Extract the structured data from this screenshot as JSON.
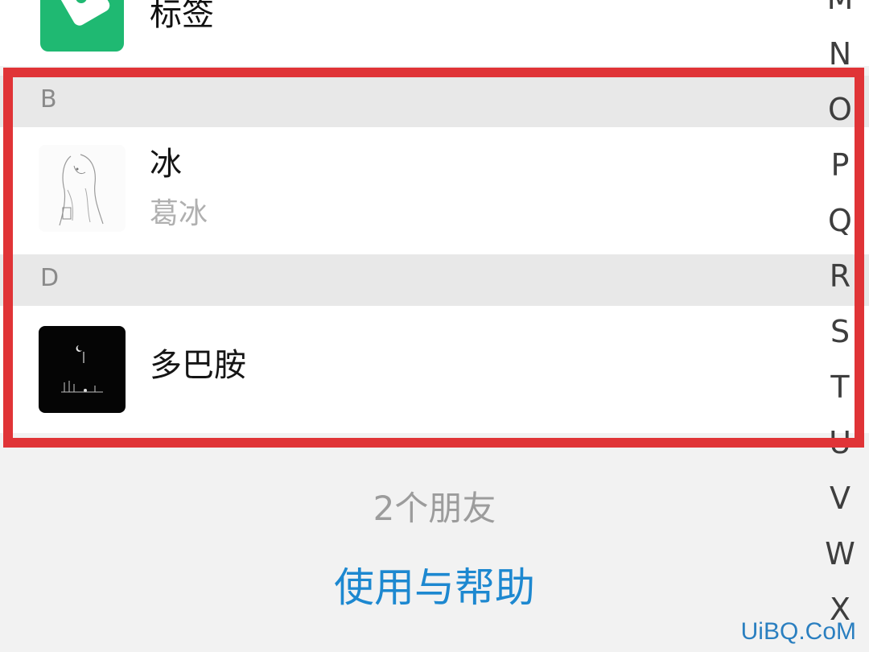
{
  "tags": {
    "label": "标签",
    "icon": "tag-icon"
  },
  "sections": [
    {
      "letter": "B"
    },
    {
      "letter": "D"
    }
  ],
  "contacts": [
    {
      "name": "冰",
      "subtitle": "葛冰",
      "avatar": "sketch-girl-avatar"
    },
    {
      "name": "多巴胺",
      "avatar": "night-scene-avatar"
    }
  ],
  "footer": {
    "friend_count": "2个朋友",
    "help_link": "使用与帮助"
  },
  "alphabet_index": [
    "M",
    "N",
    "O",
    "P",
    "Q",
    "R",
    "S",
    "T",
    "U",
    "V",
    "W",
    "X"
  ],
  "watermark": "UiBQ.CoM",
  "colors": {
    "accent_green": "#1fb972",
    "link_blue": "#1d88d0",
    "highlight_red": "#e03437",
    "section_gray": "#e8e8e8"
  }
}
